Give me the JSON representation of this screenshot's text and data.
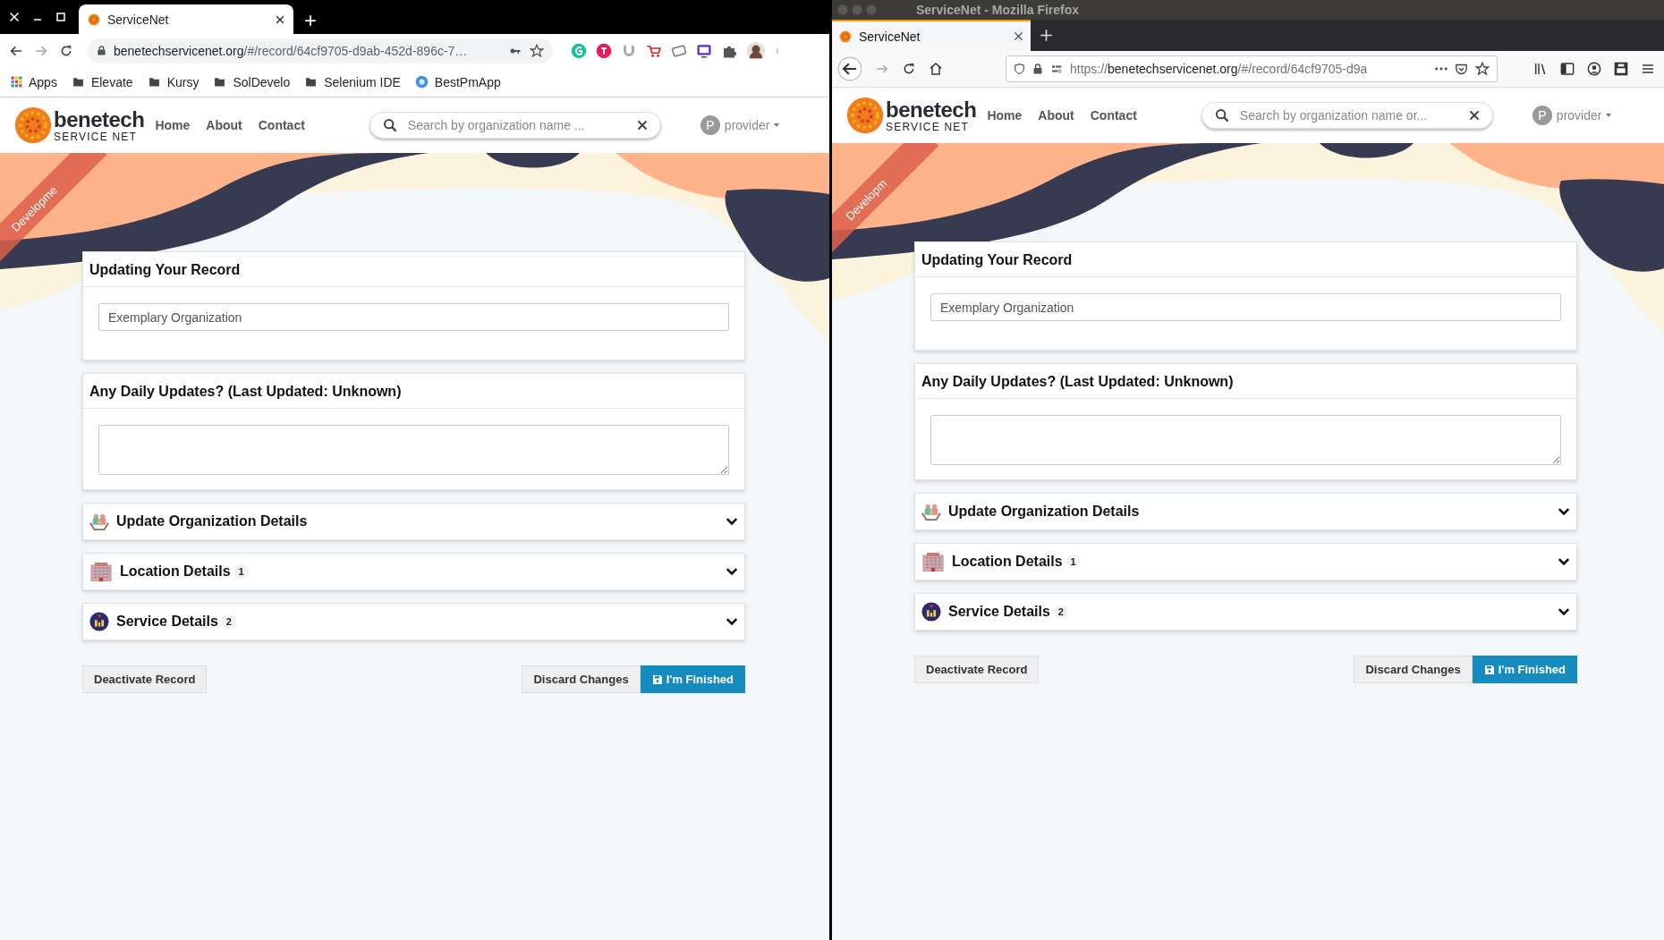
{
  "windows": [
    {
      "kind": "chrome",
      "tabs": [
        {
          "title": "ServiceNet",
          "selected": true
        }
      ],
      "address": {
        "host": "benetechservicenet.org",
        "path": "/#/record/64cf9705-d9ab-452d-896c-7…"
      },
      "bookmarks": [
        {
          "label": "Apps",
          "kind": "apps"
        },
        {
          "label": "Elevate",
          "kind": "folder"
        },
        {
          "label": "Kursy",
          "kind": "folder"
        },
        {
          "label": "SolDevelo",
          "kind": "folder"
        },
        {
          "label": "Selenium IDE",
          "kind": "folder"
        },
        {
          "label": "BestPmApp",
          "kind": "site"
        }
      ],
      "site": {
        "ribbon": "Developme",
        "logo": {
          "name": "benetech",
          "tagline": "SERVICE NET"
        },
        "nav": [
          "Home",
          "About",
          "Contact"
        ],
        "search": {
          "placeholder": "Search by organization name ..."
        },
        "user": {
          "initial": "P",
          "name": "provider"
        },
        "cards": [
          {
            "kind": "input",
            "title": "Updating Your Record",
            "value": "Exemplary Organization"
          },
          {
            "kind": "textarea",
            "title": "Any Daily Updates? (Last Updated: Unknown)"
          }
        ],
        "sections": [
          {
            "title": "Update Organization Details",
            "kind": "organization",
            "expanded": false
          },
          {
            "title": "Location Details",
            "count": "1",
            "kind": "location",
            "expanded": false
          },
          {
            "title": "Service Details",
            "count": "2",
            "kind": "service",
            "expanded": false
          }
        ],
        "actions": [
          {
            "label": "Deactivate Record",
            "kind": "secondary"
          },
          {
            "label": "Discard Changes",
            "kind": "secondary"
          },
          {
            "label": "I'm Finished",
            "kind": "primary"
          }
        ]
      }
    },
    {
      "kind": "firefox",
      "title": "ServiceNet - Mozilla Firefox",
      "tabs": [
        {
          "title": "ServiceNet",
          "selected": true
        }
      ],
      "address": {
        "scheme": "https://",
        "host": "benetechservicenet.org",
        "path": "/#/record/64cf9705-d9a"
      },
      "site": {
        "ribbon": "Developm",
        "logo": {
          "name": "benetech",
          "tagline": "SERVICE NET"
        },
        "nav": [
          "Home",
          "About",
          "Contact"
        ],
        "search": {
          "placeholder": "Search by organization name or..."
        },
        "user": {
          "initial": "P",
          "name": "provider"
        },
        "cards": [
          {
            "kind": "input",
            "title": "Updating Your Record",
            "value": "Exemplary Organization"
          },
          {
            "kind": "textarea",
            "title": "Any Daily Updates? (Last Updated: Unknown)"
          }
        ],
        "sections": [
          {
            "title": "Update Organization Details",
            "kind": "organization",
            "expanded": false
          },
          {
            "title": "Location Details",
            "count": "1",
            "kind": "location",
            "expanded": false
          },
          {
            "title": "Service Details",
            "count": "2",
            "kind": "service",
            "expanded": false
          }
        ],
        "actions": [
          {
            "label": "Deactivate Record",
            "kind": "secondary"
          },
          {
            "label": "Discard Changes",
            "kind": "secondary"
          },
          {
            "label": "I'm Finished",
            "kind": "primary"
          }
        ]
      }
    }
  ]
}
